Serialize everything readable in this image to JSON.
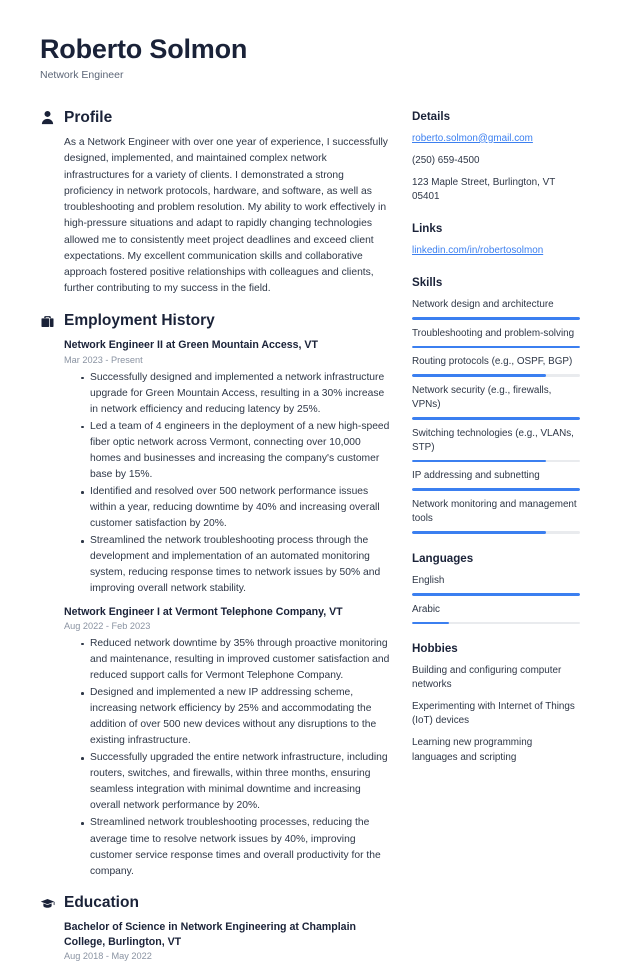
{
  "header": {
    "name": "Roberto Solmon",
    "job_title": "Network Engineer"
  },
  "accent_color": "#3b7ff0",
  "heading_color": "#1a2238",
  "profile": {
    "title": "Profile",
    "icon": "user-icon",
    "text": "As a Network Engineer with over one year of experience, I successfully designed, implemented, and maintained complex network infrastructures for a variety of clients. I demonstrated a strong proficiency in network protocols, hardware, and software, as well as troubleshooting and problem resolution. My ability to work effectively in high-pressure situations and adapt to rapidly changing technologies allowed me to consistently meet project deadlines and exceed client expectations. My excellent communication skills and collaborative approach fostered positive relationships with colleagues and clients, further contributing to my success in the field."
  },
  "employment": {
    "title": "Employment History",
    "icon": "briefcase-icon",
    "entries": [
      {
        "title": "Network Engineer II at Green Mountain Access, VT",
        "date": "Mar 2023 - Present",
        "bullets": [
          "Successfully designed and implemented a network infrastructure upgrade for Green Mountain Access, resulting in a 30% increase in network efficiency and reducing latency by 25%.",
          "Led a team of 4 engineers in the deployment of a new high-speed fiber optic network across Vermont, connecting over 10,000 homes and businesses and increasing the company's customer base by 15%.",
          "Identified and resolved over 500 network performance issues within a year, reducing downtime by 40% and increasing overall customer satisfaction by 20%.",
          "Streamlined the network troubleshooting process through the development and implementation of an automated monitoring system, reducing response times to network issues by 50% and improving overall network stability."
        ]
      },
      {
        "title": "Network Engineer I at Vermont Telephone Company, VT",
        "date": "Aug 2022 - Feb 2023",
        "bullets": [
          "Reduced network downtime by 35% through proactive monitoring and maintenance, resulting in improved customer satisfaction and reduced support calls for Vermont Telephone Company.",
          "Designed and implemented a new IP addressing scheme, increasing network efficiency by 25% and accommodating the addition of over 500 new devices without any disruptions to the existing infrastructure.",
          "Successfully upgraded the entire network infrastructure, including routers, switches, and firewalls, within three months, ensuring seamless integration with minimal downtime and increasing overall network performance by 20%.",
          "Streamlined network troubleshooting processes, reducing the average time to resolve network issues by 40%, improving customer service response times and overall productivity for the company."
        ]
      }
    ]
  },
  "education": {
    "title": "Education",
    "icon": "graduation-cap-icon",
    "entries": [
      {
        "title": "Bachelor of Science in Network Engineering at Champlain College, Burlington, VT",
        "date": "Aug 2018 - May 2022"
      }
    ]
  },
  "details": {
    "title": "Details",
    "email": "roberto.solmon@gmail.com",
    "phone": "(250) 659-4500",
    "address": "123 Maple Street, Burlington, VT 05401"
  },
  "links": {
    "title": "Links",
    "items": [
      {
        "label": "linkedin.com/in/robertosolmon"
      }
    ]
  },
  "skills": {
    "title": "Skills",
    "items": [
      {
        "label": "Network design and architecture",
        "level": 100
      },
      {
        "label": "Troubleshooting and problem-solving",
        "level": 100
      },
      {
        "label": "Routing protocols (e.g., OSPF, BGP)",
        "level": 80
      },
      {
        "label": "Network security (e.g., firewalls, VPNs)",
        "level": 100
      },
      {
        "label": "Switching technologies (e.g., VLANs, STP)",
        "level": 80
      },
      {
        "label": "IP addressing and subnetting",
        "level": 100
      },
      {
        "label": "Network monitoring and management tools",
        "level": 80
      }
    ]
  },
  "languages": {
    "title": "Languages",
    "items": [
      {
        "label": "English",
        "level": 100
      },
      {
        "label": "Arabic",
        "level": 22
      }
    ]
  },
  "hobbies": {
    "title": "Hobbies",
    "items": [
      {
        "label": "Building and configuring computer networks"
      },
      {
        "label": "Experimenting with Internet of Things (IoT) devices"
      },
      {
        "label": "Learning new programming languages and scripting"
      }
    ]
  }
}
